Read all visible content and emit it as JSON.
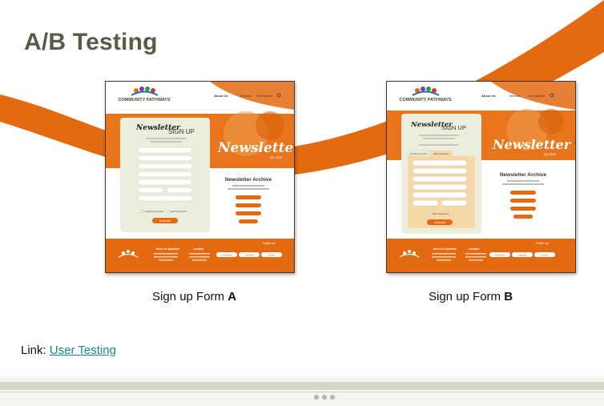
{
  "slide": {
    "title": "A/B Testing",
    "caption_a_text": "Sign up Form ",
    "caption_a_letter": "A",
    "caption_b_text": "Sign up Form ",
    "caption_b_letter": "B",
    "link_prefix": "Link: ",
    "link_text": "User Testing"
  },
  "mockup_a": {
    "logo": "COMMUNITY PATHWAYS",
    "nav": [
      "About Us",
      "Services",
      "Get Involved"
    ],
    "hero_title": "Newsletter",
    "hero_sub": "Q3 2020",
    "form_title_script": "Newsletter",
    "form_title": "SIGN UP",
    "checkbox_1": "Digital Newsletter",
    "checkbox_2": "Mail Newsletter",
    "submit": "Subscribe",
    "archive_title": "Newsletter Archive",
    "archive_text": "Browse our archive of past and current newsletters.",
    "footer_hours_title": "Hours of Operation",
    "footer_location_title": "Location",
    "footer_buttons": [
      "Newsletter",
      "Calendar",
      "Donate"
    ],
    "follow": "Follow Us"
  },
  "mockup_b": {
    "logo": "COMMUNITY PATHWAYS",
    "nav": [
      "About Us",
      "Services",
      "Get Involved"
    ],
    "hero_title": "Newsletter",
    "hero_sub": "Q3 2020",
    "form_title_script": "Newsletter",
    "form_title": "SIGN UP",
    "tabs": [
      "Digital Newsletter",
      "Mail Newsletter"
    ],
    "checkbox_1": "Mail Newsletter",
    "submit": "Subscribe",
    "archive_title": "Newsletter Archive",
    "archive_text": "Browse our archive of past and current newsletters.",
    "footer_hours_title": "Hours of Operation",
    "footer_location_title": "Location",
    "footer_buttons": [
      "Newsletter",
      "Calendar",
      "Donate"
    ],
    "follow": "Follow Us"
  },
  "colors": {
    "orange": "#e36a10",
    "title_gray": "#5a5a48",
    "link": "#1a8a84",
    "cream": "#eceedd"
  }
}
